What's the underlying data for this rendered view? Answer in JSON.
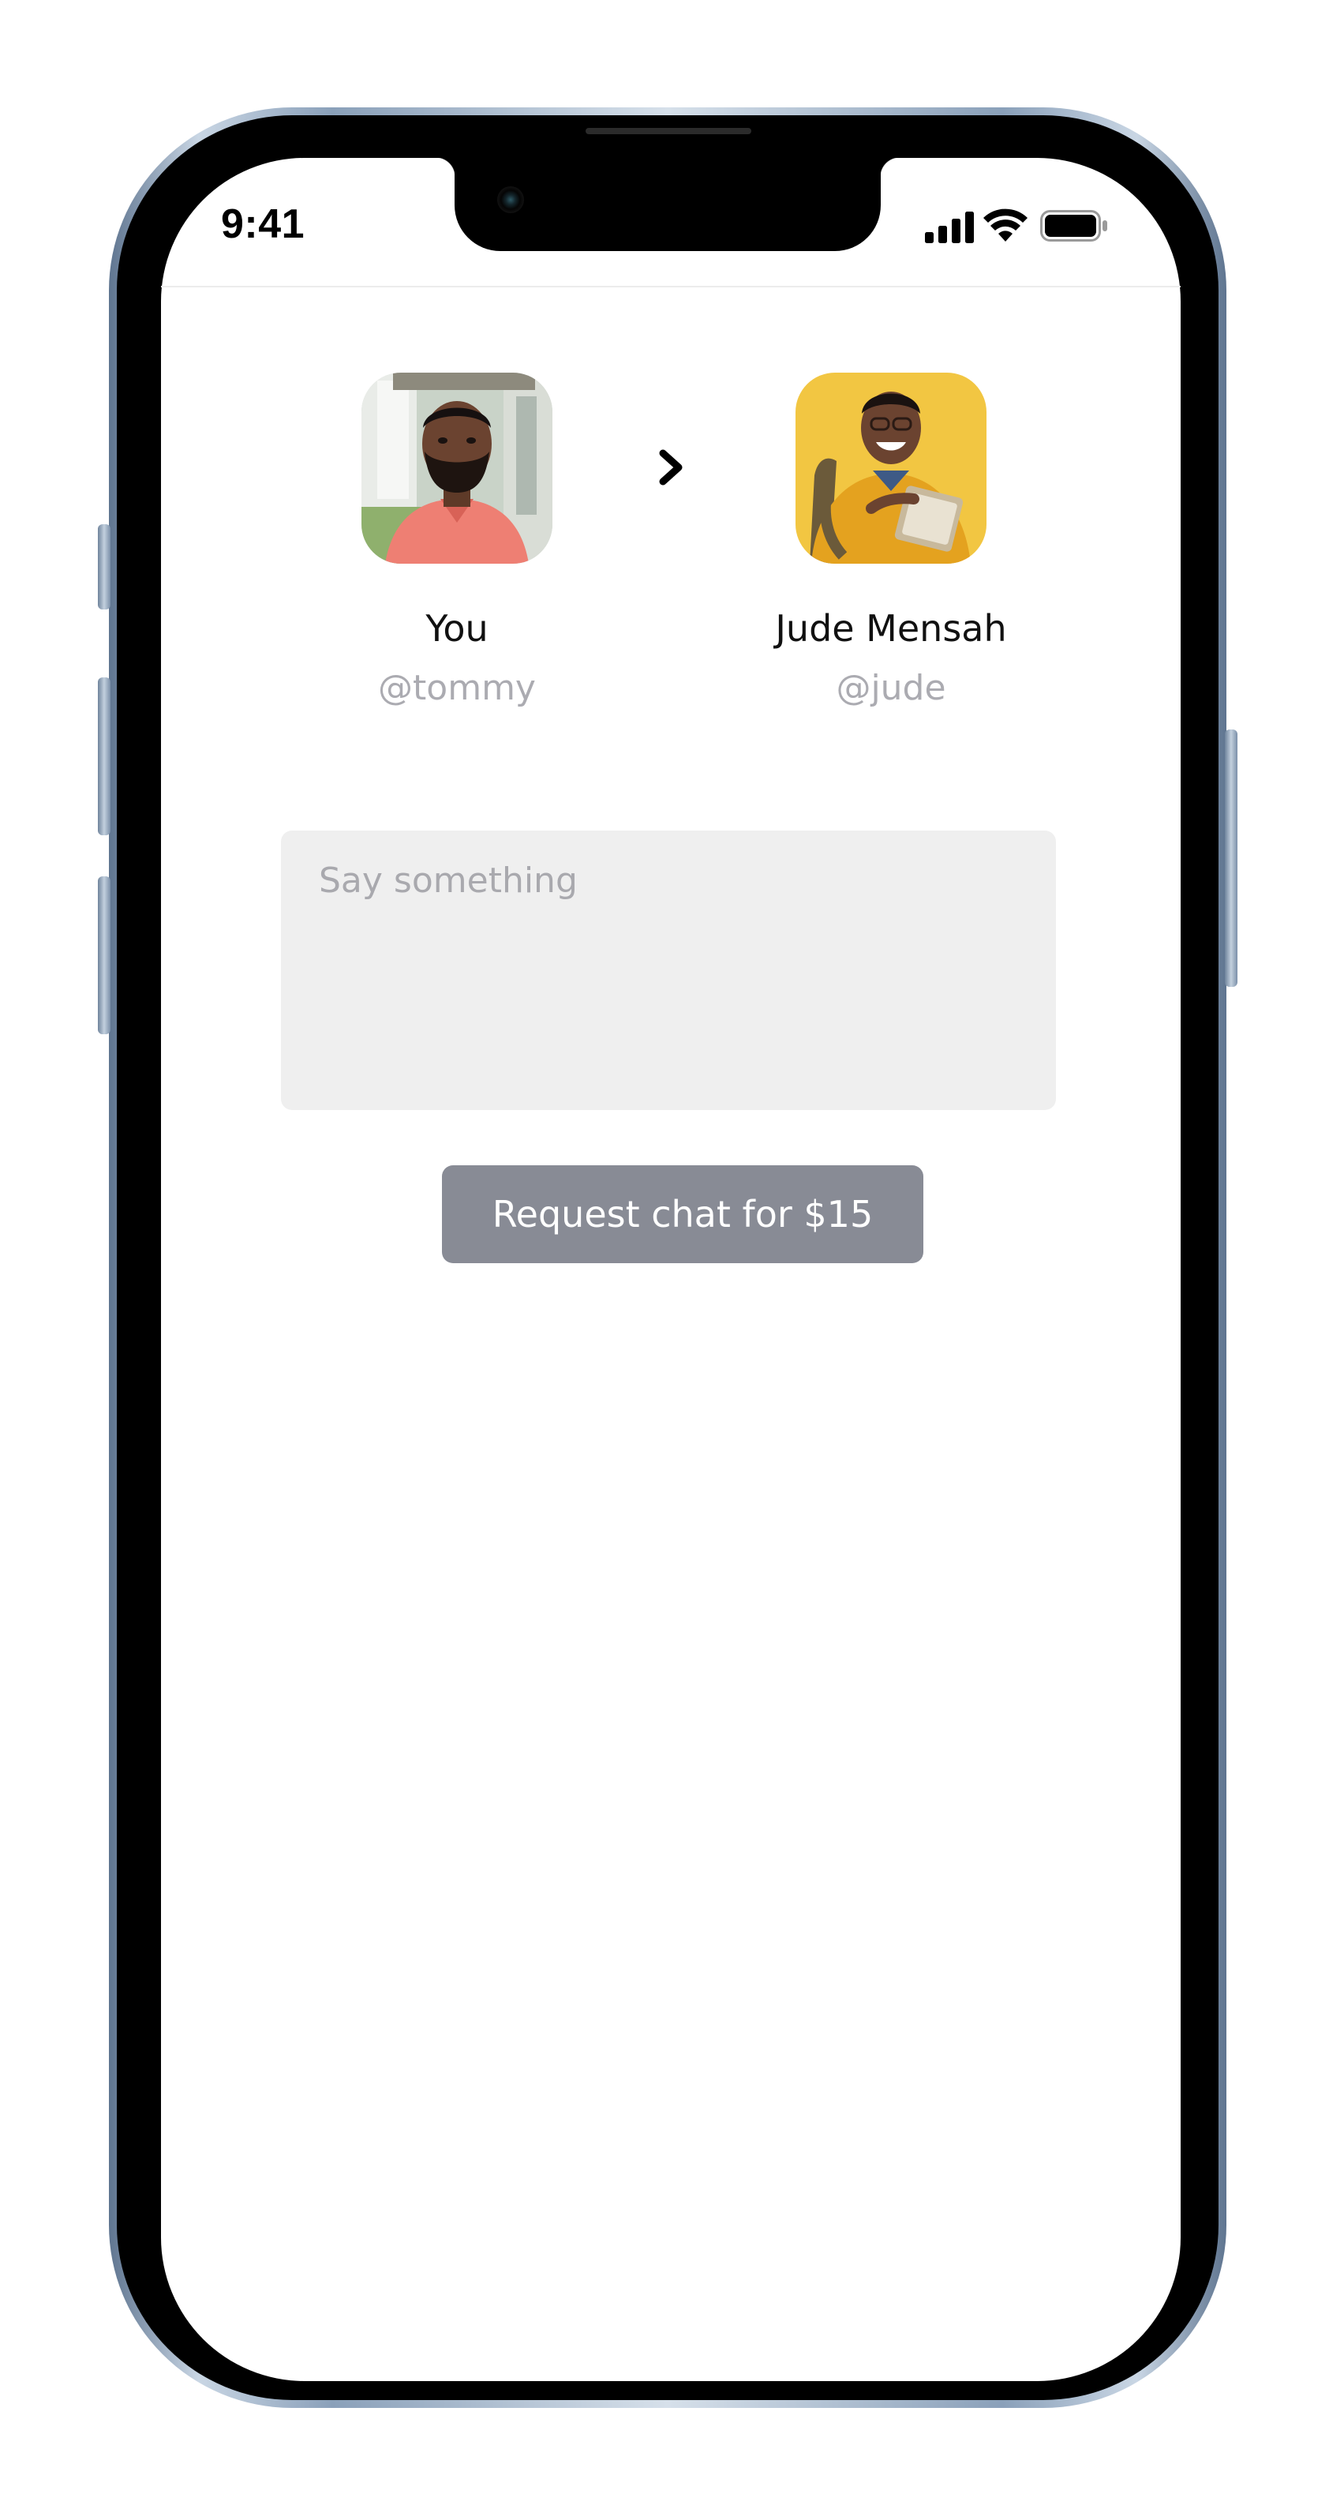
{
  "status_bar": {
    "time": "9:41",
    "icons": [
      "signal-icon",
      "wifi-icon",
      "battery-icon"
    ]
  },
  "sender": {
    "name": "You",
    "handle": "@tommy",
    "avatar": "avatar-photo-man-pink-shirt"
  },
  "recipient": {
    "name": "Jude Mensah",
    "handle": "@jude",
    "avatar": "avatar-photo-man-yellow-sweater"
  },
  "direction_icon": "chevron-right-icon",
  "message": {
    "value": "",
    "placeholder": "Say something"
  },
  "request_button": {
    "label": "Request chat for $15"
  },
  "colors": {
    "button_bg": "#888b95",
    "input_bg": "#efefef",
    "handle_text": "#ababb1",
    "jude_avatar_bg": "#f2c642",
    "tommy_shirt": "#ee7f73"
  }
}
